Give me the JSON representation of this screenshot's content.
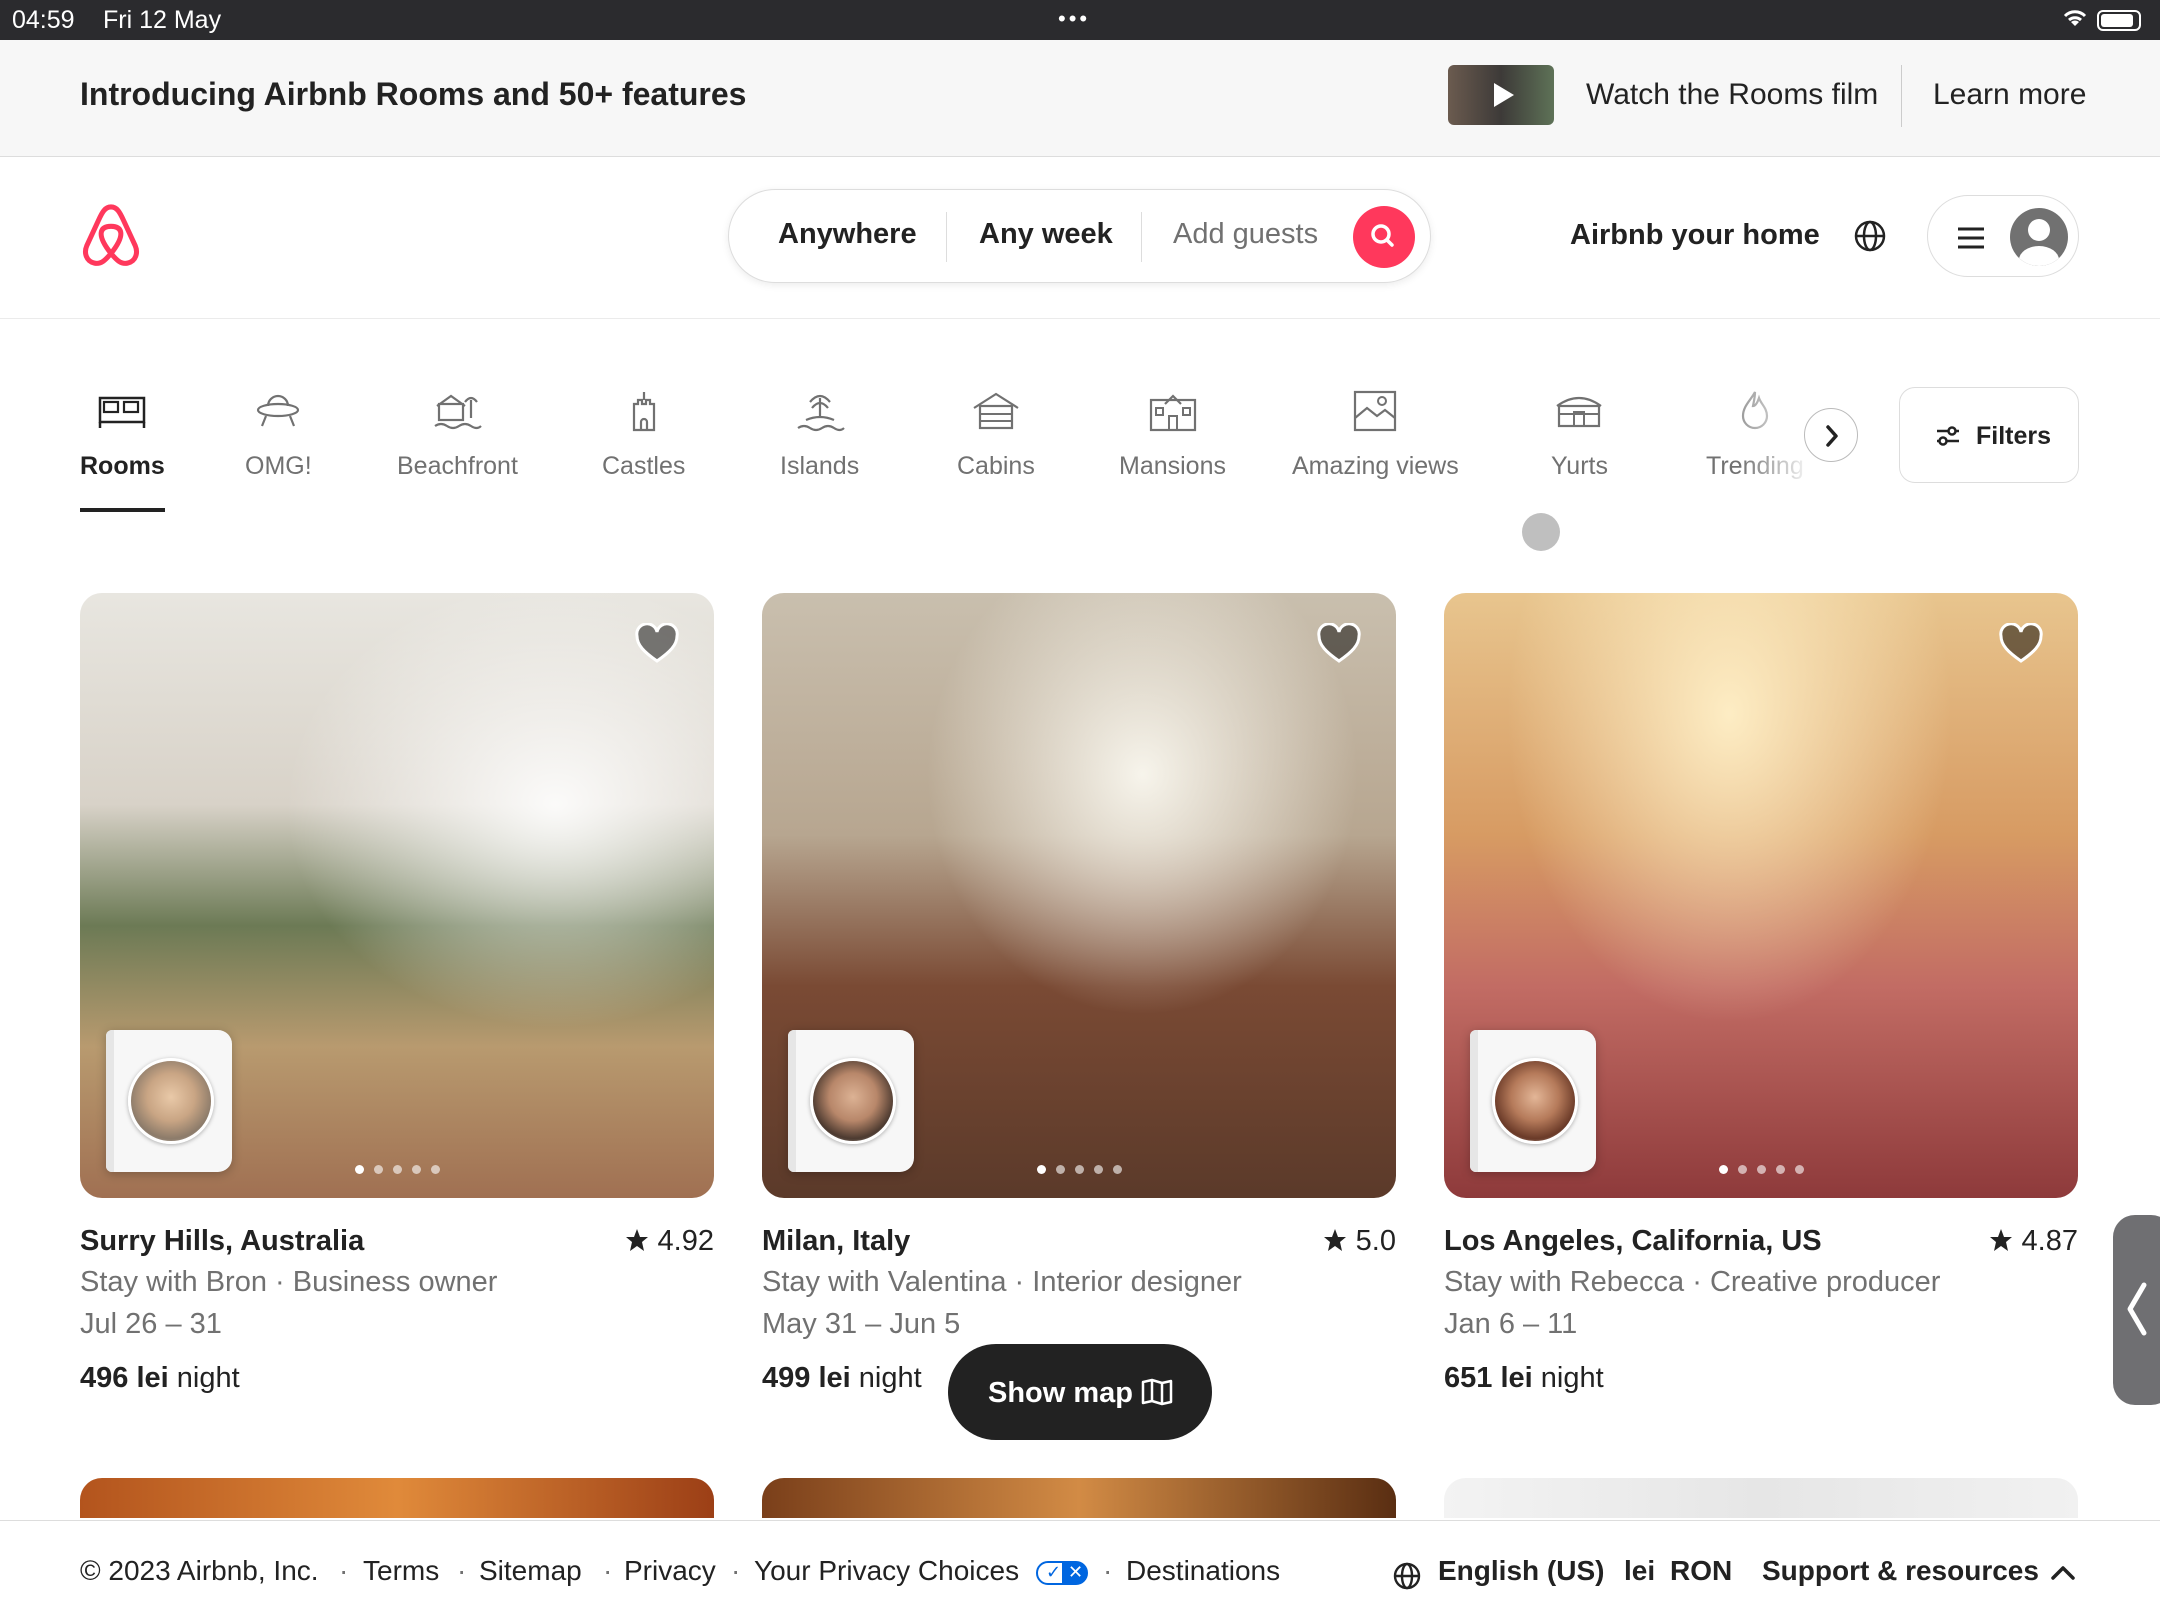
{
  "status_bar": {
    "time": "04:59",
    "date": "Fri 12 May",
    "dots": "•••"
  },
  "banner": {
    "title": "Introducing Airbnb Rooms and 50+ features",
    "watch_label": "Watch the Rooms film",
    "learn_label": "Learn more"
  },
  "header": {
    "search": {
      "where": "Anywhere",
      "when": "Any week",
      "guests_placeholder": "Add guests"
    },
    "host_label": "Airbnb your home"
  },
  "categories": [
    {
      "label": "Rooms",
      "icon": "rooms-icon",
      "active": true
    },
    {
      "label": "OMG!",
      "icon": "ufo-icon"
    },
    {
      "label": "Beachfront",
      "icon": "beachfront-icon"
    },
    {
      "label": "Castles",
      "icon": "castle-icon"
    },
    {
      "label": "Islands",
      "icon": "island-icon"
    },
    {
      "label": "Cabins",
      "icon": "cabin-icon"
    },
    {
      "label": "Mansions",
      "icon": "mansion-icon"
    },
    {
      "label": "Amazing views",
      "icon": "views-icon"
    },
    {
      "label": "Yurts",
      "icon": "yurt-icon"
    },
    {
      "label": "Trending",
      "icon": "flame-icon"
    }
  ],
  "filters_label": "Filters",
  "listings": [
    {
      "location": "Surry Hills, Australia",
      "rating": "4.92",
      "host_line": "Stay with Bron · Business owner",
      "dates": "Jul 26 – 31",
      "price": "496 lei",
      "price_unit": " night"
    },
    {
      "location": "Milan, Italy",
      "rating": "5.0",
      "host_line": "Stay with Valentina · Interior designer",
      "dates": "May 31 – Jun 5",
      "price": "499 lei",
      "price_unit": " night"
    },
    {
      "location": "Los Angeles, California, US",
      "rating": "4.87",
      "host_line": "Stay with Rebecca · Creative producer",
      "dates": "Jan 6 – 11",
      "price": "651 lei",
      "price_unit": " night"
    }
  ],
  "show_map_label": "Show map",
  "footer": {
    "copyright": "© 2023 Airbnb, Inc.",
    "links": [
      "Terms",
      "Sitemap",
      "Privacy",
      "Your Privacy Choices",
      "Destinations"
    ],
    "separator": "·",
    "language": "English (US)",
    "currency_symbol": "lei",
    "currency_code": "RON",
    "support": "Support & resources"
  },
  "colors": {
    "brand": "#ff385c",
    "text": "#222222",
    "muted": "#717171"
  }
}
